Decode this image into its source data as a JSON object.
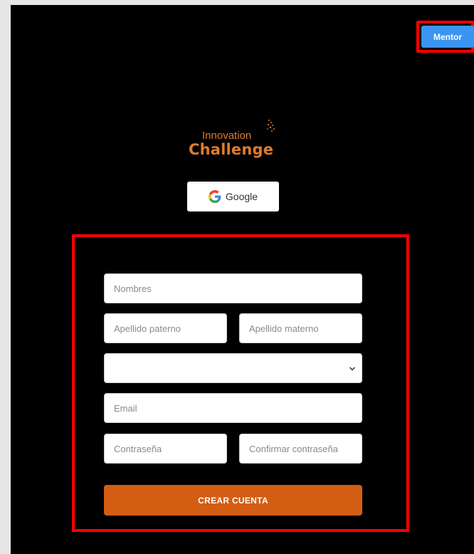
{
  "header": {
    "mentor_label": "Mentor"
  },
  "logo": {
    "line1": "Innovation",
    "line2": "Challenge",
    "sparks_icon": "sparkle-dots-icon"
  },
  "google": {
    "label": "Google",
    "icon": "google-g-icon"
  },
  "form": {
    "nombres_placeholder": "Nombres",
    "apellido_paterno_placeholder": "Apellido paterno",
    "apellido_materno_placeholder": "Apellido materno",
    "select_value": "",
    "email_placeholder": "Email",
    "contrasena_placeholder": "Contraseña",
    "confirmar_placeholder": "Confirmar contraseña",
    "submit_label": "CREAR CUENTA"
  },
  "colors": {
    "page_bg": "#000000",
    "accent_orange": "#d35d13",
    "mentor_blue": "#3b95f0",
    "highlight_red": "#ff0000"
  }
}
